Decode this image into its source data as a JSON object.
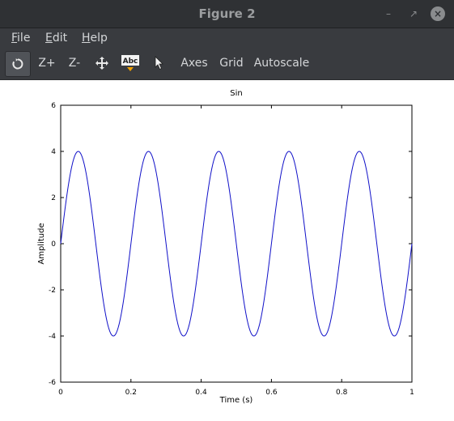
{
  "window": {
    "title": "Figure 2"
  },
  "menubar": {
    "items": [
      {
        "mnemonic": "F",
        "rest": "ile"
      },
      {
        "mnemonic": "E",
        "rest": "dit"
      },
      {
        "mnemonic": "H",
        "rest": "elp"
      }
    ]
  },
  "toolbar": {
    "rotate_icon": "rotate-icon",
    "zoom_in_label": "Z+",
    "zoom_out_label": "Z-",
    "pan_icon": "pan-icon",
    "text_icon_label": "Abc",
    "select_icon": "pointer-icon",
    "axes_label": "Axes",
    "grid_label": "Grid",
    "autoscale_label": "Autoscale"
  },
  "colors": {
    "titlebar_bg": "#2f3134",
    "toolbar_bg": "#393b3f",
    "line": "#1010c8",
    "text_icon_accent": "#f0a000"
  },
  "chart_data": {
    "type": "line",
    "title": "Sin",
    "xlabel": "Time (s)",
    "ylabel": "Amplitude",
    "xlim": [
      0,
      1
    ],
    "ylim": [
      -6,
      6
    ],
    "xticks": [
      0,
      0.2,
      0.4,
      0.6,
      0.8,
      1
    ],
    "xtick_labels": [
      "0",
      "0.2",
      "0.4",
      "0.6",
      "0.8",
      "1"
    ],
    "yticks": [
      -6,
      -4,
      -2,
      0,
      2,
      4,
      6
    ],
    "ytick_labels": [
      "-6",
      "-4",
      "-2",
      "0",
      "2",
      "4",
      "6"
    ],
    "grid": false,
    "series": [
      {
        "function": "4*sin(2*pi*5*t)",
        "amplitude": 4,
        "frequency_hz": 5,
        "t_start": 0,
        "t_end": 1,
        "color": "#1010c8"
      }
    ]
  }
}
